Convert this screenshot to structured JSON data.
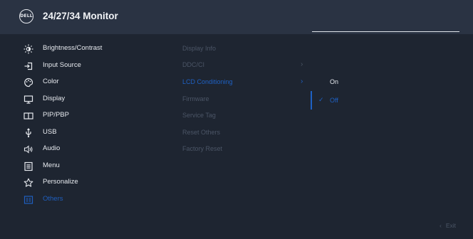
{
  "header": {
    "logo_text": "DELL",
    "title": "24/27/34 Monitor"
  },
  "menu": {
    "items": [
      {
        "label": "Brightness/Contrast",
        "icon": "brightness-icon"
      },
      {
        "label": "Input Source",
        "icon": "input-source-icon"
      },
      {
        "label": "Color",
        "icon": "color-icon"
      },
      {
        "label": "Display",
        "icon": "display-icon"
      },
      {
        "label": "PIP/PBP",
        "icon": "pip-pbp-icon"
      },
      {
        "label": "USB",
        "icon": "usb-icon"
      },
      {
        "label": "Audio",
        "icon": "audio-icon"
      },
      {
        "label": "Menu",
        "icon": "menu-icon"
      },
      {
        "label": "Personalize",
        "icon": "star-icon"
      },
      {
        "label": "Others",
        "icon": "others-icon",
        "active": true
      }
    ]
  },
  "submenu": {
    "items": [
      {
        "label": "Display Info"
      },
      {
        "label": "DDC/CI",
        "chevron": "›"
      },
      {
        "label": "LCD Conditioning",
        "chevron": "›",
        "selected": true
      },
      {
        "label": "Firmware"
      },
      {
        "label": "Service Tag"
      },
      {
        "label": "Reset Others"
      },
      {
        "label": "Factory Reset"
      }
    ]
  },
  "options": {
    "items": [
      {
        "label": "On"
      },
      {
        "label": "Off",
        "check": "✓",
        "selected": true
      }
    ]
  },
  "footer": {
    "exit_chevron": "‹",
    "exit_label": "Exit"
  },
  "colors": {
    "background": "#1e2531",
    "header": "#2a3343",
    "accent": "#1e61c4",
    "dim_text": "#4b5566"
  }
}
